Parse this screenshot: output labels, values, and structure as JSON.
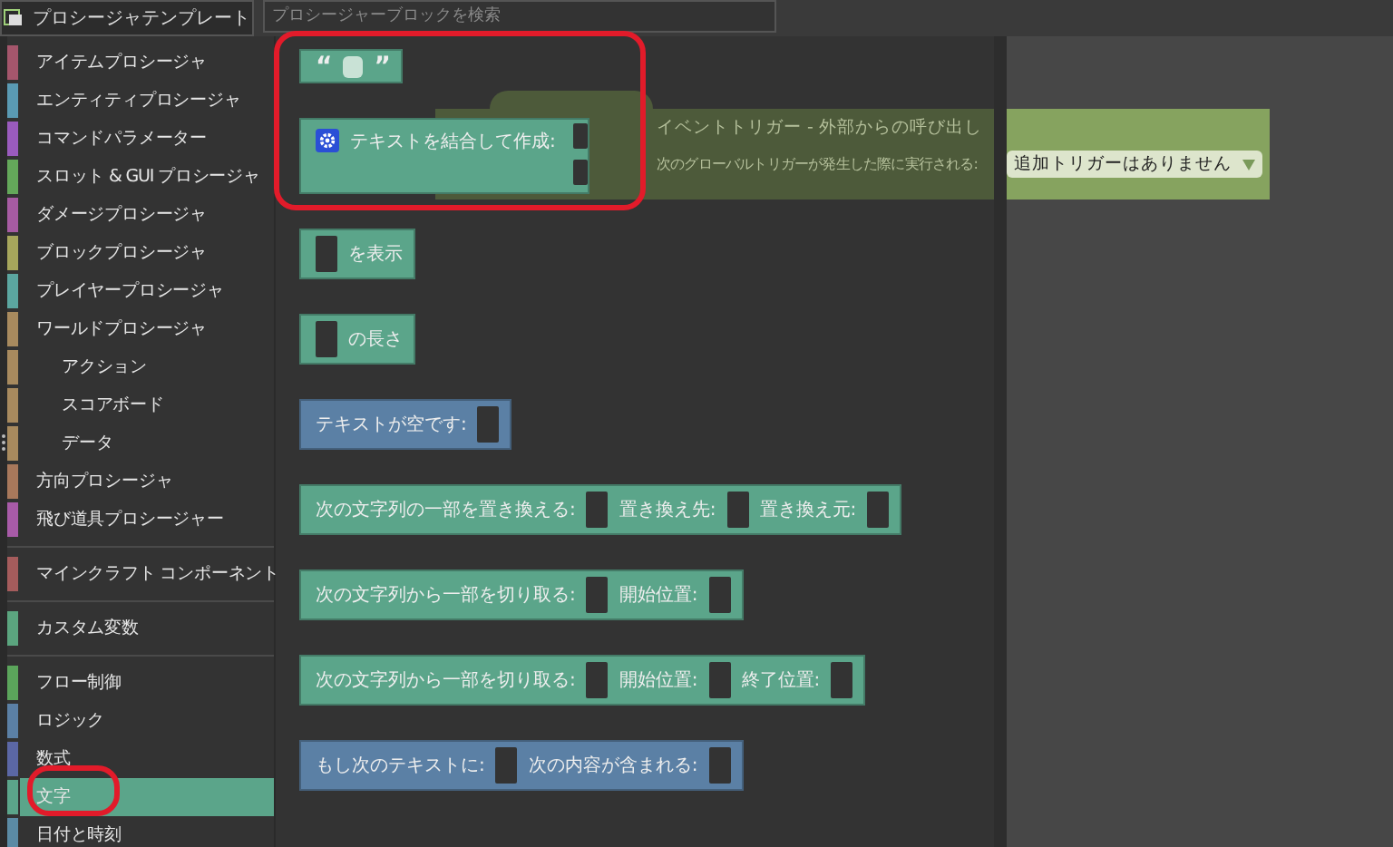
{
  "toolbar": {
    "template_button": "プロシージャテンプレート",
    "search": {
      "placeholder": "プロシージャーブロックを検索"
    }
  },
  "sidebar": {
    "groups": [
      {
        "items": [
          {
            "label": "アイテムプロシージャ",
            "color": "#a5566c",
            "selected": false
          },
          {
            "label": "エンティティプロシージャ",
            "color": "#5a9ab3",
            "selected": false
          },
          {
            "label": "コマンドパラメーター",
            "color": "#9a5bbd",
            "selected": false
          },
          {
            "label": "スロット & GUI プロシージャ",
            "color": "#64a85a",
            "selected": false
          },
          {
            "label": "ダメージプロシージャ",
            "color": "#a65ba2",
            "selected": false
          },
          {
            "label": "ブロックプロシージャ",
            "color": "#a6a65c",
            "selected": false
          },
          {
            "label": "プレイヤープロシージャ",
            "color": "#5ba6a0",
            "selected": false
          },
          {
            "label": "ワールドプロシージャ",
            "color": "#a88a5e",
            "selected": false,
            "children": [
              {
                "label": "アクション",
                "color": "#a88a5e",
                "selected": false
              },
              {
                "label": "スコアボード",
                "color": "#a88a5e",
                "selected": false
              },
              {
                "label": "データ",
                "color": "#a88a5e",
                "selected": false
              }
            ]
          },
          {
            "label": "方向プロシージャ",
            "color": "#a8785b",
            "selected": false
          },
          {
            "label": "飛び道具プロシージャー",
            "color": "#a85ba8",
            "selected": false
          }
        ]
      },
      {
        "items": [
          {
            "label": "マインクラフト コンポーネント",
            "color": "#a55c5c",
            "selected": false
          }
        ]
      },
      {
        "items": [
          {
            "label": "カスタム変数",
            "color": "#5ba57f",
            "selected": false
          }
        ]
      },
      {
        "items": [
          {
            "label": "フロー制御",
            "color": "#5ba55b",
            "selected": false
          },
          {
            "label": "ロジック",
            "color": "#5b80a5",
            "selected": false
          },
          {
            "label": "数式",
            "color": "#5b67a5",
            "selected": false
          },
          {
            "label": "文字",
            "color": "#5ba58a",
            "selected": true
          },
          {
            "label": "日付と時刻",
            "color": "#5b8ba5",
            "selected": false
          }
        ]
      }
    ]
  },
  "workspace": {
    "event_block": {
      "title": "イベントトリガー - 外部からの呼び出し",
      "subtitle": "次のグローバルトリガーが発生した際に実行される:",
      "dropdown": "追加トリガーはありません"
    }
  },
  "flyout": {
    "blocks": [
      {
        "kind": "value",
        "color": "#5ba58a",
        "parts": [
          {
            "kind": "label",
            "text": "“"
          },
          {
            "kind": "field"
          },
          {
            "kind": "label",
            "text": "”"
          }
        ]
      },
      {
        "kind": "multi",
        "color": "#5ba58a",
        "parts": [
          {
            "kind": "gear"
          },
          {
            "kind": "label",
            "text": "テキストを結合して作成:"
          }
        ]
      },
      {
        "kind": "value",
        "color": "#5ba58a",
        "parts": [
          {
            "kind": "socket"
          },
          {
            "kind": "label",
            "text": "を表示"
          }
        ]
      },
      {
        "kind": "value",
        "color": "#5ba58a",
        "parts": [
          {
            "kind": "socket"
          },
          {
            "kind": "label",
            "text": "の長さ"
          }
        ]
      },
      {
        "kind": "value",
        "color": "#5b80a5",
        "parts": [
          {
            "kind": "label",
            "text": "テキストが空です:"
          },
          {
            "kind": "socket"
          }
        ]
      },
      {
        "kind": "value",
        "color": "#5ba58a",
        "parts": [
          {
            "kind": "label",
            "text": "次の文字列の一部を置き換える:"
          },
          {
            "kind": "socket"
          },
          {
            "kind": "label",
            "text": "置き換え先:"
          },
          {
            "kind": "socket"
          },
          {
            "kind": "label",
            "text": "置き換え元:"
          },
          {
            "kind": "socket"
          }
        ]
      },
      {
        "kind": "value",
        "color": "#5ba58a",
        "parts": [
          {
            "kind": "label",
            "text": "次の文字列から一部を切り取る:"
          },
          {
            "kind": "socket"
          },
          {
            "kind": "label",
            "text": "開始位置:"
          },
          {
            "kind": "socket"
          }
        ]
      },
      {
        "kind": "value",
        "color": "#5ba58a",
        "parts": [
          {
            "kind": "label",
            "text": "次の文字列から一部を切り取る:"
          },
          {
            "kind": "socket"
          },
          {
            "kind": "label",
            "text": "開始位置:"
          },
          {
            "kind": "socket"
          },
          {
            "kind": "label",
            "text": "終了位置:"
          },
          {
            "kind": "socket"
          }
        ]
      },
      {
        "kind": "value",
        "color": "#5b80a5",
        "parts": [
          {
            "kind": "label",
            "text": "もし次のテキストに:"
          },
          {
            "kind": "socket"
          },
          {
            "kind": "label",
            "text": "次の内容が含まれる:"
          },
          {
            "kind": "socket"
          }
        ]
      }
    ]
  }
}
